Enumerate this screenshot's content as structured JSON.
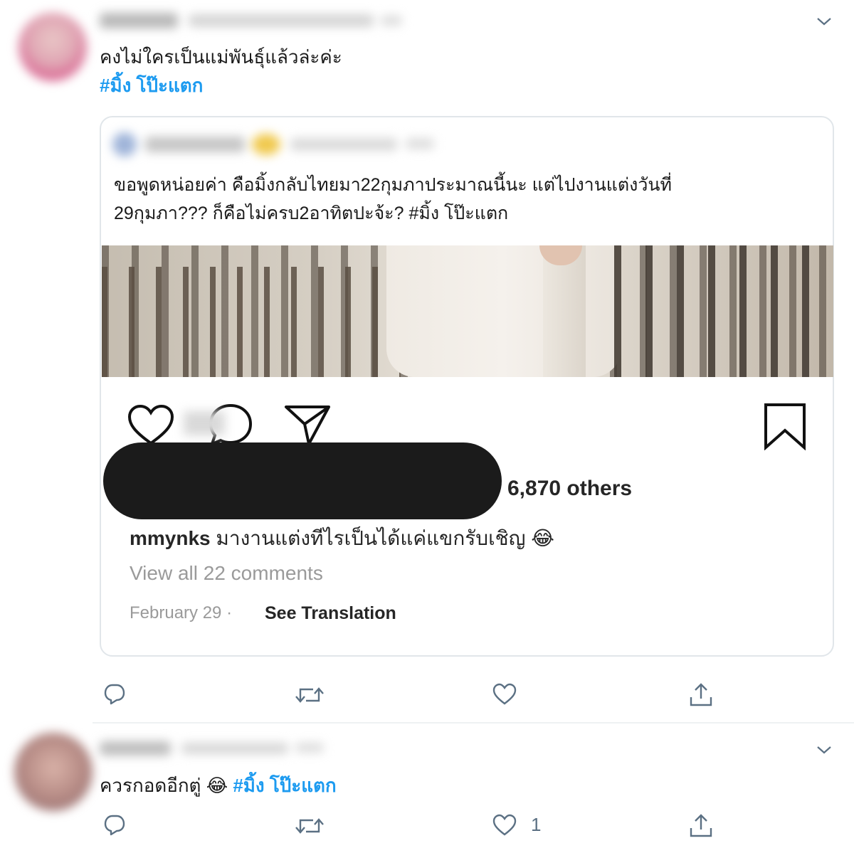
{
  "tweet1": {
    "text": "คงไม่ใครเป็นแม่พันธุ์แล้วล่ะค่ะ",
    "hashtag": "#มิ้ง โป๊ะแตก",
    "quoted": {
      "text_line1": "ขอพูดหน่อยค่า คือมิ้งกลับไทยมา22กุมภาประมาณนี้นะ แต่ไปงานแต่งวันที่",
      "text_line2": "29กุมภา??? ก็คือไม่ครบ2อาทิตปะจ้ะ? #มิ้ง โป๊ะแตก",
      "instagram": {
        "likes_suffix": "6,870 others",
        "comment_user": "mmynks",
        "comment_text": "มางานแต่งทีไรเป็นได้แค่แขกรับเชิญ",
        "comment_emoji": "😂",
        "view_all": "View all 22 comments",
        "date": "February 29",
        "separator": "·",
        "see_translation": "See Translation"
      }
    }
  },
  "tweet2": {
    "text": "ควรกอดอีกตู่",
    "emoji": "😂",
    "hashtag": "#มิ้ง โป๊ะแตก",
    "like_count": "1"
  },
  "icons": {
    "more": "chevron-down-icon",
    "reply": "reply-icon",
    "retweet": "retweet-icon",
    "like": "heart-icon",
    "share": "share-icon",
    "ig_like": "heart-icon",
    "ig_comment": "comment-icon",
    "ig_share": "send-icon",
    "ig_save": "bookmark-icon"
  },
  "colors": {
    "hashtag": "#1d9bf0",
    "action_icon": "#5b7083"
  }
}
